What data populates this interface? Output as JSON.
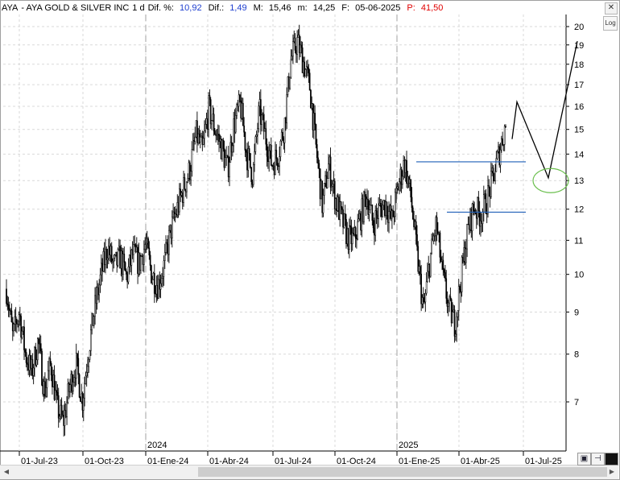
{
  "header": {
    "symbol": "AYA",
    "name": "- AYA GOLD & SILVER INC",
    "period": "1 d",
    "dif_pct_label": "Dif. %:",
    "dif_pct_value": "10,92",
    "dif_label": "Dif.:",
    "dif_value": "1,49",
    "max_label": "M:",
    "max_value": "15,46",
    "min_label": "m:",
    "min_value": "14,25",
    "date_label": "F:",
    "date_value": "05-06-2025",
    "p_label": "P:",
    "p_value": "41,50"
  },
  "controls": {
    "log_label": "Log",
    "close_icon": "close-icon",
    "save_icon": "save-icon",
    "pin_icon": "pin-icon",
    "color_icon": "color-square-icon"
  },
  "colors": {
    "candle": "#000000",
    "grid": "#d9d9d9",
    "hline": "#1f5fb8",
    "ellipse": "#6bbf4e",
    "projection": "#000000",
    "title_value": "#1f3fcf",
    "price_value": "#e00000"
  },
  "chart_data": {
    "type": "candlestick",
    "y_scale": "log",
    "y_ticks": [
      7,
      8,
      9,
      10,
      11,
      12,
      13,
      14,
      15,
      16,
      17,
      18,
      19,
      20
    ],
    "x_ticks": [
      "01-Jul-23",
      "01-Oct-23",
      "01-Ene-24",
      "01-Abr-24",
      "01-Jul-24",
      "01-Oct-24",
      "01-Ene-25",
      "01-Abr-25",
      "01-Jul-25"
    ],
    "year_markers": [
      "2024",
      "2025"
    ],
    "price_path": [
      9.6,
      8.4,
      9.0,
      8.0,
      7.6,
      8.3,
      7.2,
      7.8,
      6.9,
      6.6,
      7.3,
      7.8,
      7.0,
      8.1,
      9.1,
      10.0,
      10.8,
      10.2,
      10.5,
      9.9,
      10.6,
      10.3,
      10.9,
      10.0,
      9.7,
      10.3,
      11.3,
      12.0,
      12.7,
      13.4,
      14.8,
      14.1,
      15.9,
      15.0,
      14.3,
      13.4,
      15.2,
      16.1,
      14.0,
      13.2,
      15.8,
      14.7,
      13.6,
      14.0,
      15.2,
      18.2,
      19.2,
      18.1,
      16.9,
      14.2,
      12.1,
      13.6,
      12.4,
      11.7,
      11.1,
      11.0,
      11.7,
      12.5,
      11.5,
      12.0,
      12.2,
      11.6,
      12.8,
      13.7,
      12.4,
      10.5,
      9.0,
      10.4,
      11.5,
      10.0,
      9.1,
      8.7,
      10.0,
      11.3,
      12.1,
      11.8,
      12.3,
      13.1,
      14.1,
      15.2
    ],
    "horizontal_lines": [
      13.7,
      11.9
    ],
    "projection_path": [
      [
        14.6,
        16.2
      ],
      [
        13.1,
        13.1
      ],
      [
        19.2,
        19.2
      ]
    ],
    "ellipse_center": 13.0
  }
}
